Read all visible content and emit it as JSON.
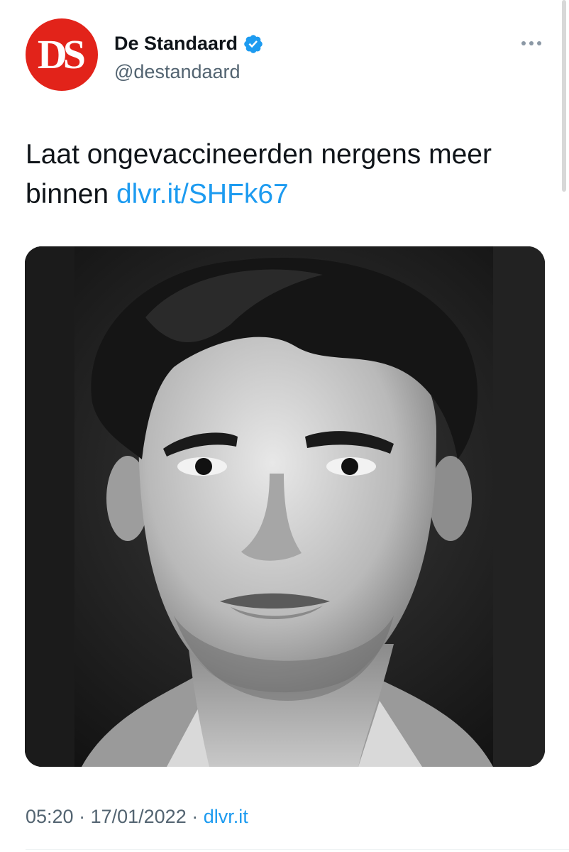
{
  "author": {
    "avatar_text": "DS",
    "display_name": "De Standaard",
    "handle": "@destandaard",
    "verified": true,
    "avatar_color": "#e2231a"
  },
  "tweet": {
    "text": "Laat ongevaccineerden nergens meer binnen",
    "link": "dlvr.it/SHFk67"
  },
  "media": {
    "type": "photo",
    "style": "black-and-white portrait"
  },
  "meta": {
    "time": "05:20",
    "date": "17/01/2022",
    "source": "dlvr.it",
    "separator": " · "
  },
  "icons": {
    "verified": "verified-badge-icon",
    "more": "more-options-icon"
  },
  "colors": {
    "link": "#1d9bf0",
    "secondary_text": "#536471",
    "verified": "#1d9bf0"
  }
}
